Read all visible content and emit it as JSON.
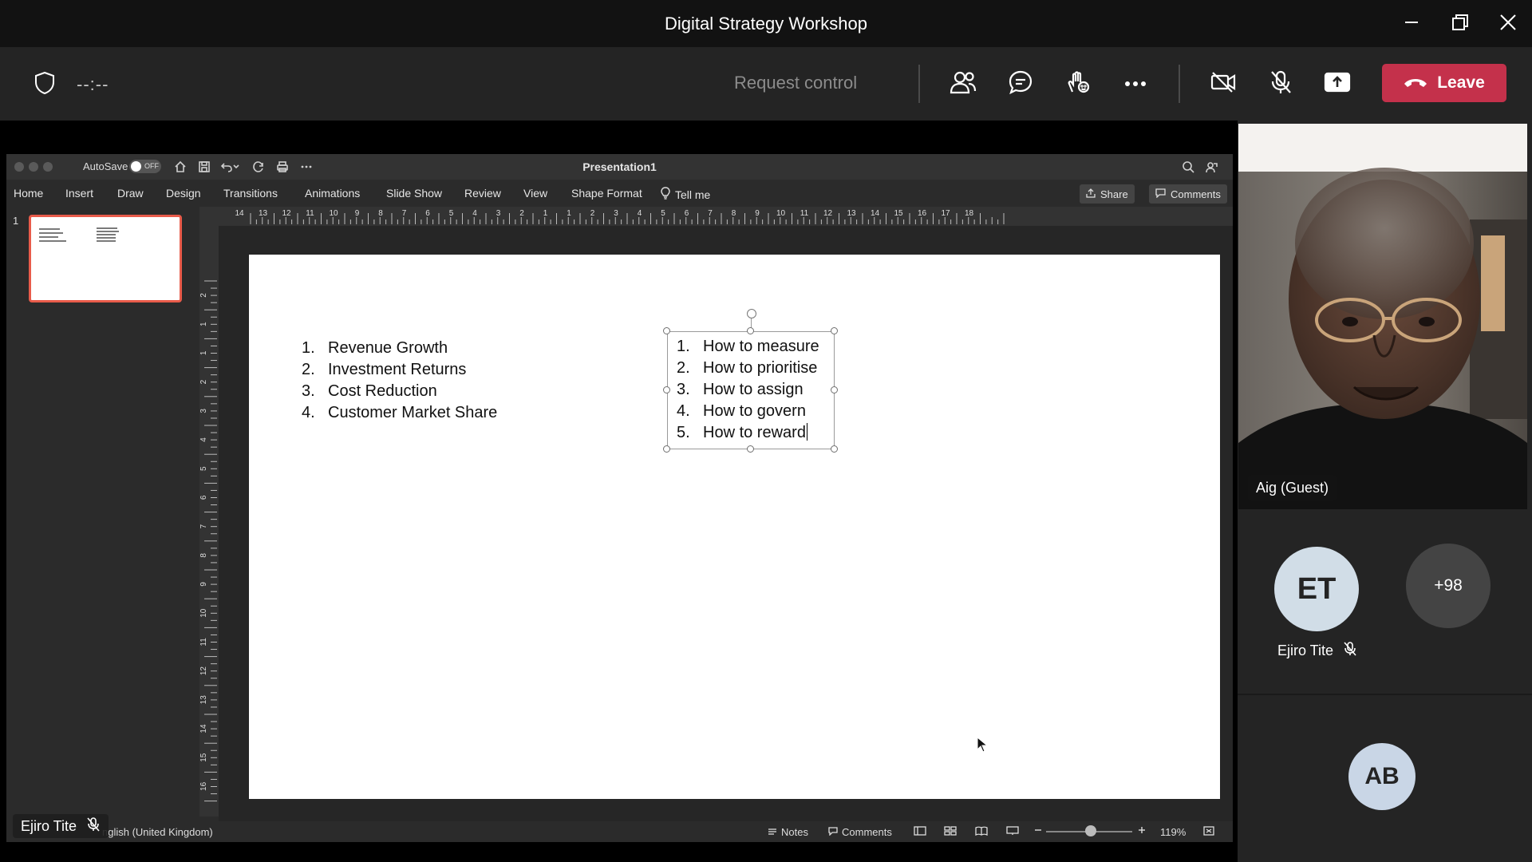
{
  "window": {
    "title": "Digital Strategy Workshop"
  },
  "meeting_bar": {
    "timer": "--:--",
    "request_control": "Request control",
    "leave_label": "Leave",
    "colors": {
      "leave": "#c4314b",
      "bar": "#242424"
    }
  },
  "ppt": {
    "autosave_label": "AutoSave",
    "autosave_state": "OFF",
    "doc_title": "Presentation1",
    "tabs": [
      "Home",
      "Insert",
      "Draw",
      "Design",
      "Transitions",
      "Animations",
      "Slide Show",
      "Review",
      "View",
      "Shape Format"
    ],
    "tell_me": "Tell me",
    "share_label": "Share",
    "comments_label": "Comments",
    "slide_number": "1",
    "ruler_h_labels": [
      "14",
      "13",
      "12",
      "11",
      "10",
      "9",
      "8",
      "7",
      "6",
      "5",
      "4",
      "3",
      "2",
      "1",
      "1",
      "2",
      "3",
      "4",
      "5",
      "6",
      "7",
      "8",
      "9",
      "10",
      "11",
      "12",
      "13",
      "14",
      "15",
      "16",
      "17",
      "18"
    ],
    "ruler_v_labels": [
      "2",
      "1",
      "1",
      "2",
      "3",
      "4",
      "5",
      "6",
      "7",
      "8",
      "9",
      "10",
      "11",
      "12",
      "13",
      "14",
      "15",
      "16"
    ],
    "left_list": [
      {
        "num": "1.",
        "text": "Revenue Growth"
      },
      {
        "num": "2.",
        "text": "Investment Returns"
      },
      {
        "num": "3.",
        "text": "Cost Reduction"
      },
      {
        "num": "4.",
        "text": "Customer Market Share"
      }
    ],
    "right_list": [
      {
        "num": "1.",
        "text": "How to measure"
      },
      {
        "num": "2.",
        "text": "How to prioritise"
      },
      {
        "num": "3.",
        "text": "How to assign"
      },
      {
        "num": "4.",
        "text": "How to govern"
      },
      {
        "num": "5.",
        "text": "How to reward"
      }
    ],
    "status": {
      "language": "nglish (United Kingdom)",
      "notes": "Notes",
      "comments": "Comments",
      "zoom": "119%"
    }
  },
  "presenter_name": "Ejiro Tite",
  "participants": {
    "video_name": "Aig (Guest)",
    "et_initials": "ET",
    "et_name": "Ejiro Tite",
    "more_count": "+98",
    "ab_initials": "AB"
  }
}
